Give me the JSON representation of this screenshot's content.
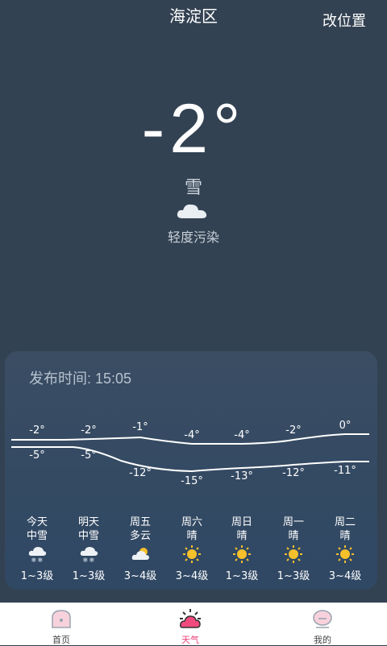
{
  "header": {
    "city": "海淀区",
    "change_location": "改位置"
  },
  "current": {
    "temperature": "-2°",
    "condition": "雪",
    "air_quality": "轻度污染"
  },
  "forecast": {
    "publish_time": "发布时间: 15:05",
    "days": [
      {
        "day": "今天",
        "weather": "中雪",
        "high": "-2°",
        "low": "-5°",
        "wind": "1~3级",
        "icon": "snow-icon"
      },
      {
        "day": "明天",
        "weather": "中雪",
        "high": "-2°",
        "low": "-5°",
        "wind": "1~3级",
        "icon": "snow-icon"
      },
      {
        "day": "周五",
        "weather": "多云",
        "high": "-1°",
        "low": "-12°",
        "wind": "3~4级",
        "icon": "partly-cloudy-icon"
      },
      {
        "day": "周六",
        "weather": "晴",
        "high": "-4°",
        "low": "-15°",
        "wind": "3~4级",
        "icon": "sun-icon"
      },
      {
        "day": "周日",
        "weather": "晴",
        "high": "-4°",
        "low": "-13°",
        "wind": "1~3级",
        "icon": "sun-icon"
      },
      {
        "day": "周一",
        "weather": "晴",
        "high": "-2°",
        "low": "-12°",
        "wind": "1~3级",
        "icon": "sun-icon"
      },
      {
        "day": "周二",
        "weather": "晴",
        "high": "0°",
        "low": "-11°",
        "wind": "3~4级",
        "icon": "sun-icon"
      }
    ]
  },
  "tabs": [
    {
      "label": "首页"
    },
    {
      "label": "天气",
      "active": true
    },
    {
      "label": "我的"
    }
  ],
  "colors": {
    "background": "#334252",
    "active_tab": "#e9437a"
  }
}
